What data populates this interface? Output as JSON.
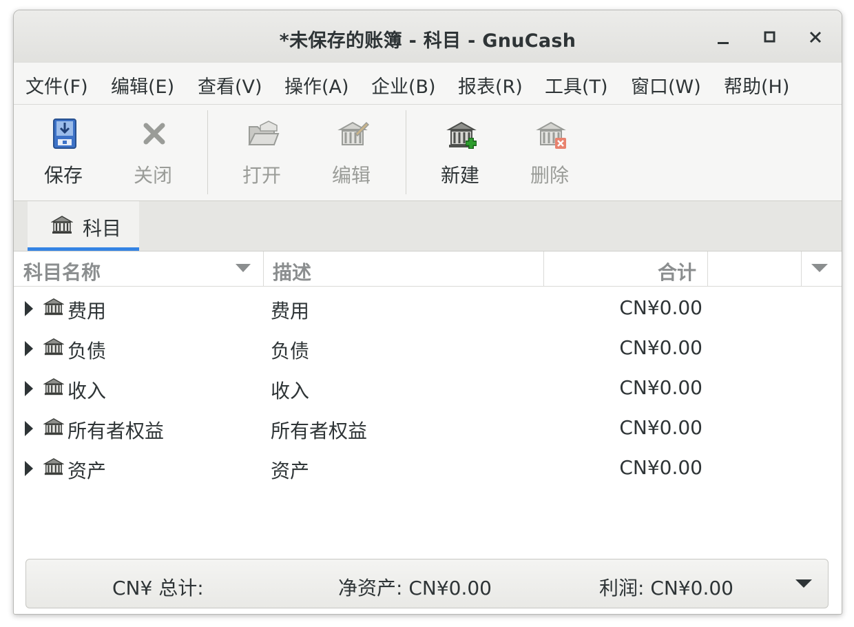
{
  "window": {
    "title": "*未保存的账簿 - 科目 - GnuCash",
    "controls": {
      "minimize": "–",
      "maximize": "▫",
      "close": "✕"
    }
  },
  "menu": [
    "文件(F)",
    "编辑(E)",
    "查看(V)",
    "操作(A)",
    "企业(B)",
    "报表(R)",
    "工具(T)",
    "窗口(W)",
    "帮助(H)"
  ],
  "toolbar": {
    "save": "保存",
    "close": "关闭",
    "open": "打开",
    "edit": "编辑",
    "new": "新建",
    "delete": "删除"
  },
  "tab": {
    "label": "科目"
  },
  "columns": {
    "name": "科目名称",
    "description": "描述",
    "total": "合计"
  },
  "accounts": [
    {
      "name": "费用",
      "description": "费用",
      "total": "CN¥0.00"
    },
    {
      "name": "负债",
      "description": "负债",
      "total": "CN¥0.00"
    },
    {
      "name": "收入",
      "description": "收入",
      "total": "CN¥0.00"
    },
    {
      "name": "所有者权益",
      "description": "所有者权益",
      "total": "CN¥0.00"
    },
    {
      "name": "资产",
      "description": "资产",
      "total": "CN¥0.00"
    }
  ],
  "summary": {
    "currency_total": "CN¥ 总计:",
    "net_assets": "净资产: CN¥0.00",
    "profit": "利润: CN¥0.00"
  },
  "colors": {
    "accent": "#3584e4",
    "add_green": "#2e9e2e",
    "delete_red": "#e8826e"
  }
}
